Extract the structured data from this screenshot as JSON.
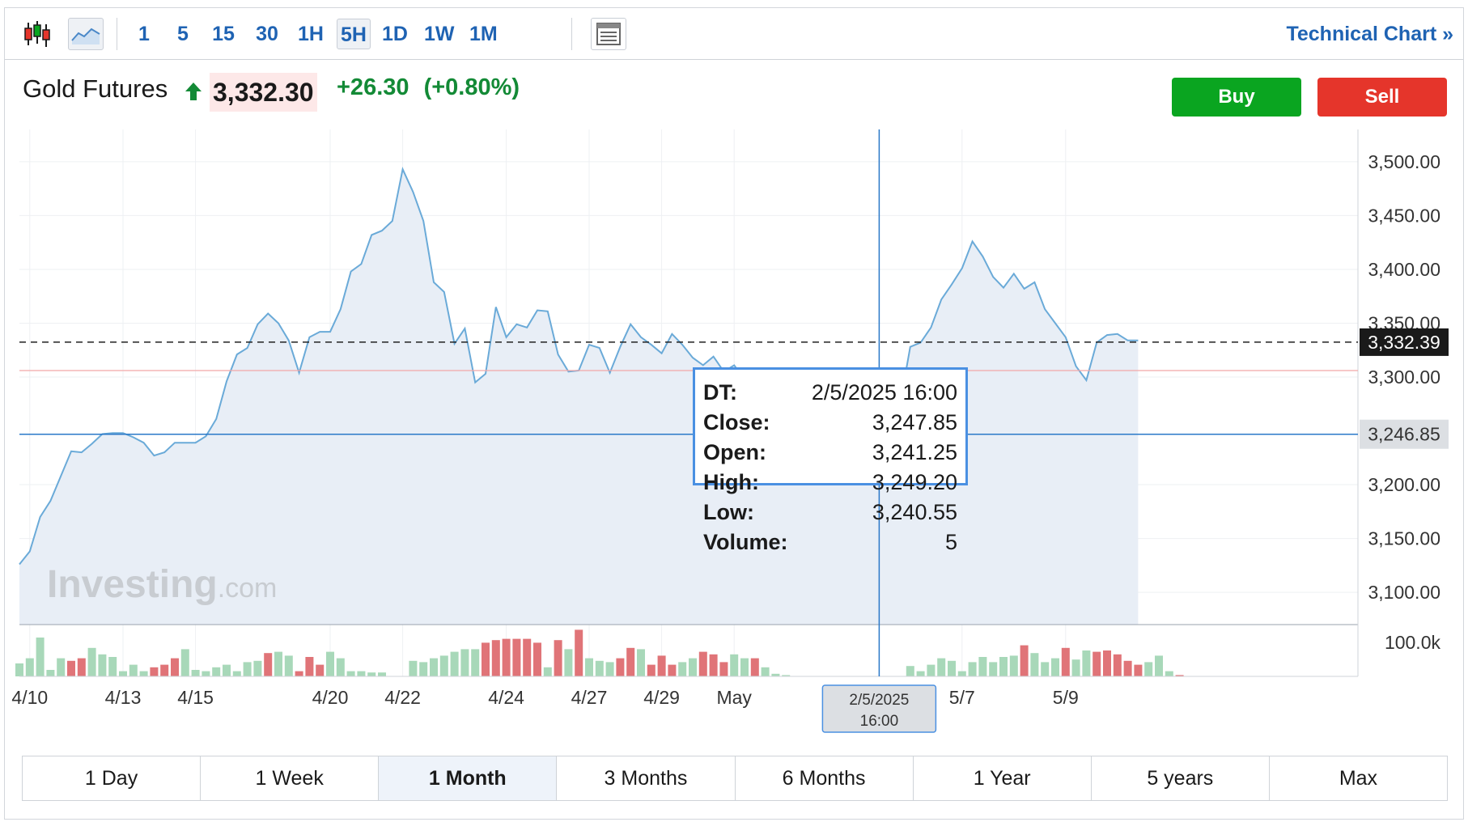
{
  "toolbar": {
    "intervals": [
      "1",
      "5",
      "15",
      "30",
      "1H",
      "5H",
      "1D",
      "1W",
      "1M"
    ],
    "active_interval": "5H",
    "technical_chart_label": "Technical Chart »"
  },
  "header": {
    "instrument": "Gold Futures",
    "price": "3,332.30",
    "change": "+26.30",
    "change_pct": "(+0.80%)",
    "buy_label": "Buy",
    "sell_label": "Sell"
  },
  "colors": {
    "accent": "#1f63b3",
    "up": "#138a36",
    "buy": "#0aa520",
    "sell": "#e5352b",
    "line": "#6aaad8",
    "area": "#e8eef6",
    "volume_up": "#a8d8b9",
    "volume_down": "#e07478",
    "crosshair": "#2a78c8"
  },
  "watermark": "Investing.com",
  "tooltip": {
    "rows": [
      {
        "key": "DT:",
        "value": "2/5/2025 16:00"
      },
      {
        "key": "Close:",
        "value": "3,247.85"
      },
      {
        "key": "Open:",
        "value": "3,241.25"
      },
      {
        "key": "High:",
        "value": "3,249.20"
      },
      {
        "key": "Low:",
        "value": "3,240.55"
      },
      {
        "key": "Volume:",
        "value": "5"
      }
    ]
  },
  "crosshair_label": [
    "2/5/2025",
    "16:00"
  ],
  "range_buttons": [
    "1 Day",
    "1 Week",
    "1 Month",
    "3 Months",
    "6 Months",
    "1 Year",
    "5 years",
    "Max"
  ],
  "active_range": "1 Month",
  "chart_data": {
    "type": "area",
    "title": "",
    "xlabel": "",
    "ylabel": "",
    "ylim": [
      3070,
      3530
    ],
    "y_ticks": [
      "3,500.00",
      "3,450.00",
      "3,400.00",
      "3,350.00",
      "3,300.00",
      "3,200.00",
      "3,150.00",
      "3,100.00"
    ],
    "y_tick_values": [
      3500,
      3450,
      3400,
      3350,
      3300,
      3200,
      3150,
      3100
    ],
    "x_ticks": [
      "4/10",
      "4/13",
      "4/15",
      "4/20",
      "4/22",
      "4/24",
      "4/27",
      "4/29",
      "May",
      "5/7",
      "5/9"
    ],
    "x_tick_index": [
      1,
      10,
      17,
      30,
      37,
      47,
      55,
      62,
      69,
      91,
      101
    ],
    "last_price_label": "3,332.39",
    "last_price": 3332.39,
    "crosshair_price_label": "3,246.85",
    "crosshair_price": 3246.85,
    "crosshair_index": 83,
    "previous_close": 3306,
    "volume_axis_label": "100.0k",
    "series": [
      {
        "values": [
          3126,
          3138,
          3170,
          3185,
          3208,
          3231,
          3230,
          3238,
          3247,
          3248,
          3248,
          3244,
          3239,
          3227,
          3230,
          3239,
          3239,
          3239,
          3245,
          3261,
          3296,
          3321,
          3327,
          3349,
          3359,
          3350,
          3334,
          3304,
          3337,
          3342,
          3342,
          3363,
          3398,
          3405,
          3432,
          3436,
          3445,
          3493,
          3472,
          3445,
          3388,
          3379,
          3331,
          3345,
          3295,
          3303,
          3365,
          3337,
          3349,
          3346,
          3362,
          3361,
          3321,
          3305,
          3306,
          3330,
          3327,
          3304,
          3328,
          3349,
          3337,
          3330,
          3322,
          3340,
          3330,
          3318,
          3311,
          3319,
          3305,
          3311,
          3298,
          3291,
          3281,
          3276,
          3277,
          3272,
          3252,
          3251,
          3245,
          3256,
          3275,
          3273,
          3242,
          3247,
          3280,
          3274,
          3328,
          3332,
          3346,
          3372,
          3386,
          3401,
          3426,
          3412,
          3393,
          3383,
          3396,
          3382,
          3388,
          3363,
          3350,
          3337,
          3310,
          3297,
          3332,
          3339,
          3340,
          3334,
          3334
        ]
      }
    ],
    "volume": {
      "values": [
        10,
        14,
        30,
        5,
        14,
        12,
        14,
        22,
        17,
        15,
        4,
        9,
        4,
        7,
        9,
        14,
        21,
        5,
        4,
        7,
        9,
        4,
        11,
        12,
        18,
        19,
        16,
        4,
        15,
        9,
        19,
        14,
        4,
        4,
        3,
        3,
        0,
        0,
        12,
        11,
        14,
        16,
        19,
        21,
        21,
        26,
        28,
        29,
        29,
        29,
        26,
        7,
        28,
        21,
        36,
        14,
        12,
        11,
        14,
        22,
        21,
        9,
        16,
        9,
        11,
        14,
        19,
        17,
        11,
        17,
        14,
        14,
        7,
        2,
        1,
        0,
        0,
        0,
        0,
        0,
        0,
        0,
        0,
        0,
        0,
        0,
        8,
        4,
        9,
        14,
        12,
        4,
        11,
        15,
        11,
        15,
        16,
        24,
        18,
        11,
        14,
        22,
        13,
        20,
        19,
        20,
        17,
        12,
        9,
        11,
        16,
        4,
        1
      ],
      "down": [
        false,
        false,
        false,
        false,
        false,
        true,
        true,
        false,
        false,
        false,
        false,
        false,
        false,
        true,
        true,
        true,
        false,
        false,
        false,
        false,
        false,
        false,
        false,
        false,
        true,
        false,
        false,
        true,
        true,
        true,
        false,
        false,
        false,
        false,
        false,
        false,
        false,
        false,
        false,
        false,
        false,
        false,
        false,
        false,
        false,
        true,
        true,
        true,
        true,
        true,
        true,
        false,
        true,
        false,
        true,
        false,
        false,
        false,
        true,
        true,
        false,
        true,
        true,
        true,
        false,
        false,
        true,
        true,
        true,
        false,
        false,
        true,
        false,
        false,
        false,
        false,
        false,
        false,
        false,
        false,
        false,
        false,
        false,
        false,
        false,
        false,
        false,
        false,
        false,
        false,
        false,
        false,
        false,
        false,
        false,
        false,
        false,
        true,
        false,
        false,
        false,
        true,
        false,
        false,
        true,
        true,
        true,
        true,
        true,
        false,
        false,
        false,
        true
      ]
    }
  }
}
